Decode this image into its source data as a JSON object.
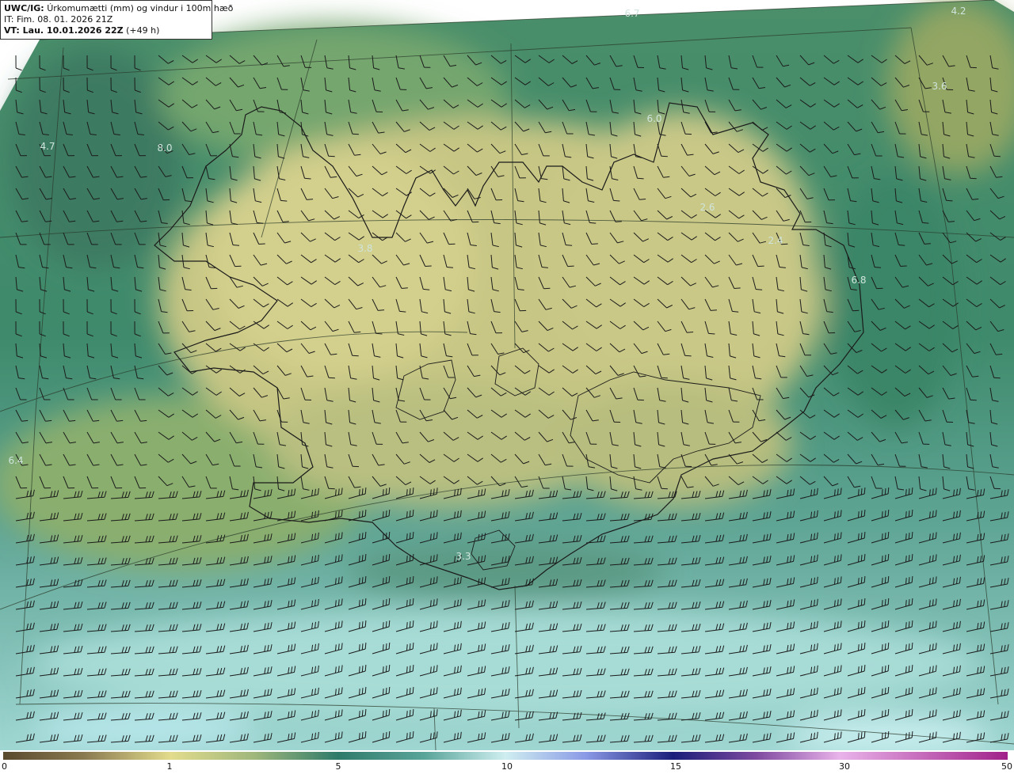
{
  "header": {
    "model_label": "UWC/IG:",
    "title": "Úrkomumætti (mm) og vindur i 100m hæð",
    "init_time": "IT: Fim. 08. 01. 2026 21Z",
    "valid_label": "VT: Lau. 10.01.2026 22Z",
    "lead_time": "(+49 h)"
  },
  "map_labels": [
    {
      "id": "label-6-7",
      "text": "6.7"
    },
    {
      "id": "label-4-2",
      "text": "4.2"
    },
    {
      "id": "label-3-6",
      "text": "3.6"
    },
    {
      "id": "label-6-0",
      "text": "6.0"
    },
    {
      "id": "label-4-7",
      "text": "4.7"
    },
    {
      "id": "label-8-0",
      "text": "8.0"
    },
    {
      "id": "label-2-6",
      "text": "2.6"
    },
    {
      "id": "label-2-4",
      "text": "2.4"
    },
    {
      "id": "label-3-8",
      "text": "3.8"
    },
    {
      "id": "label-6-8",
      "text": "6.8"
    },
    {
      "id": "label-6-4",
      "text": "6.4"
    },
    {
      "id": "label-3-3",
      "text": "3.3"
    }
  ],
  "colorbar": {
    "ticks": [
      "0",
      "1",
      "5",
      "10",
      "15",
      "30",
      "50"
    ],
    "colors": [
      "#5a4a2e",
      "#a08a5a",
      "#e2dc8c",
      "#7fa77a",
      "#2f7b6a",
      "#4f9b92",
      "#bfe8e6",
      "#7f8fe0",
      "#1a1e7a",
      "#c98fd8",
      "#e39ee0",
      "#a0208a"
    ]
  }
}
